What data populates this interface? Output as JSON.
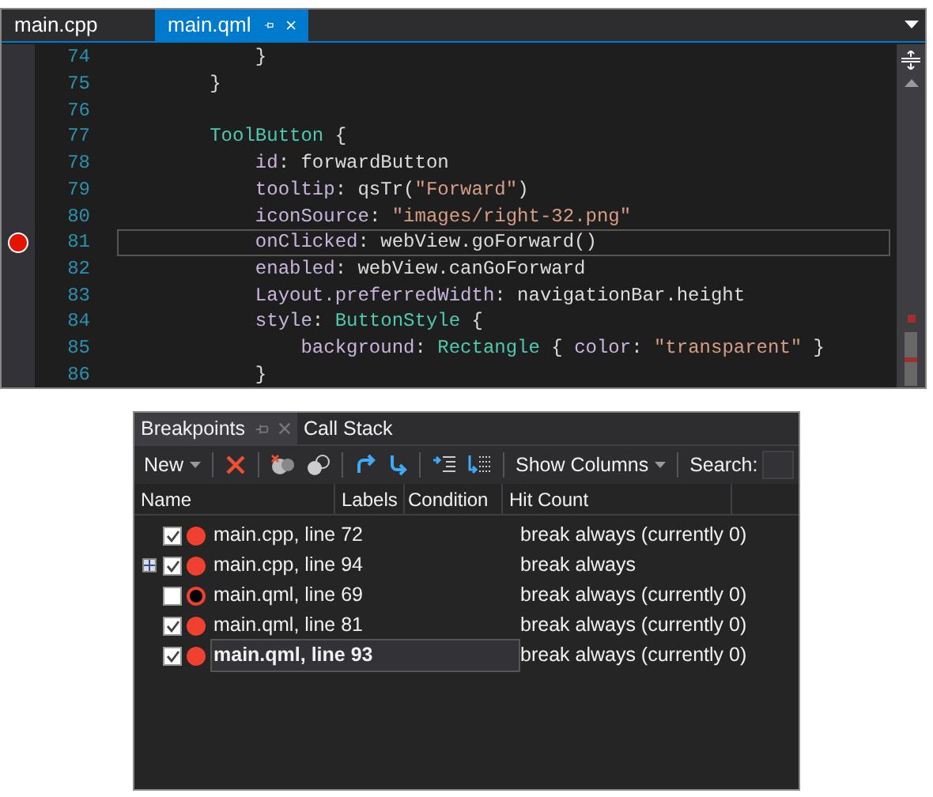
{
  "editor": {
    "tabs": [
      {
        "label": "main.cpp",
        "selected": false
      },
      {
        "label": "main.qml",
        "selected": true
      }
    ],
    "lines": [
      {
        "number": "74",
        "breakpoint": false,
        "current": false,
        "tokens": [
          {
            "kind": "punct",
            "text": "            }"
          }
        ]
      },
      {
        "number": "75",
        "breakpoint": false,
        "current": false,
        "tokens": [
          {
            "kind": "punct",
            "text": "        }"
          }
        ]
      },
      {
        "number": "76",
        "breakpoint": false,
        "current": false
      },
      {
        "number": "77",
        "breakpoint": false,
        "current": false,
        "tokens": [
          {
            "kind": "type",
            "text": "        ToolButton"
          },
          {
            "kind": "punct",
            "text": " {"
          }
        ]
      },
      {
        "number": "78",
        "breakpoint": false,
        "current": false,
        "tokens": [
          {
            "kind": "prop",
            "text": "            id"
          },
          {
            "kind": "punct",
            "text": ": forwardButton"
          }
        ]
      },
      {
        "number": "79",
        "breakpoint": false,
        "current": false,
        "tokens": [
          {
            "kind": "prop",
            "text": "            tooltip"
          },
          {
            "kind": "punct",
            "text": ": qsTr("
          },
          {
            "kind": "string",
            "text": "\"Forward\""
          },
          {
            "kind": "punct",
            "text": ")"
          }
        ]
      },
      {
        "number": "80",
        "breakpoint": false,
        "current": false,
        "tokens": [
          {
            "kind": "prop",
            "text": "            iconSource"
          },
          {
            "kind": "punct",
            "text": ": "
          },
          {
            "kind": "string",
            "text": "\"images/right-32.png\""
          }
        ]
      },
      {
        "number": "81",
        "breakpoint": true,
        "current": true,
        "tokens": [
          {
            "kind": "prop",
            "text": "            onClicked"
          },
          {
            "kind": "punct",
            "text": ": webView.goForward()"
          }
        ]
      },
      {
        "number": "82",
        "breakpoint": false,
        "current": false,
        "tokens": [
          {
            "kind": "prop",
            "text": "            enabled"
          },
          {
            "kind": "punct",
            "text": ": webView.canGoForward"
          }
        ]
      },
      {
        "number": "83",
        "breakpoint": false,
        "current": false,
        "tokens": [
          {
            "kind": "prop",
            "text": "            Layout.preferredWidth"
          },
          {
            "kind": "punct",
            "text": ": navigationBar.height"
          }
        ]
      },
      {
        "number": "84",
        "breakpoint": false,
        "current": false,
        "tokens": [
          {
            "kind": "prop",
            "text": "            style"
          },
          {
            "kind": "punct",
            "text": ": "
          },
          {
            "kind": "type",
            "text": "ButtonStyle"
          },
          {
            "kind": "punct",
            "text": " {"
          }
        ]
      },
      {
        "number": "85",
        "breakpoint": false,
        "current": false,
        "tokens": [
          {
            "kind": "prop",
            "text": "                background"
          },
          {
            "kind": "punct",
            "text": ": "
          },
          {
            "kind": "type",
            "text": "Rectangle"
          },
          {
            "kind": "punct",
            "text": " { "
          },
          {
            "kind": "prop",
            "text": "color"
          },
          {
            "kind": "punct",
            "text": ": "
          },
          {
            "kind": "string",
            "text": "\"transparent\""
          },
          {
            "kind": "punct",
            "text": " }"
          }
        ]
      },
      {
        "number": "86",
        "breakpoint": false,
        "current": false,
        "tokens": [
          {
            "kind": "punct",
            "text": "            }"
          }
        ]
      }
    ]
  },
  "panel": {
    "tabs": [
      {
        "label": "Breakpoints",
        "selected": true
      },
      {
        "label": "Call Stack",
        "selected": false
      }
    ],
    "toolbar": {
      "new_label": "New",
      "show_columns_label": "Show Columns",
      "search_label": "Search:"
    },
    "columns": [
      "Name",
      "Labels",
      "Condition",
      "Hit Count"
    ],
    "rows": [
      {
        "kind": "leaf",
        "name": "main.cpp, line 72",
        "hit_count": "break always (currently 0)",
        "checked": true,
        "enabled": true,
        "selected": false
      },
      {
        "kind": "group",
        "name": "main.cpp, line 94",
        "hit_count": "break always",
        "checked": true,
        "enabled": true,
        "selected": false
      },
      {
        "kind": "leaf",
        "name": "main.qml, line 69",
        "hit_count": "break always (currently 0)",
        "checked": false,
        "enabled": false,
        "selected": false
      },
      {
        "kind": "leaf",
        "name": "main.qml, line 81",
        "hit_count": "break always (currently 0)",
        "checked": true,
        "enabled": true,
        "selected": false
      },
      {
        "kind": "leaf",
        "name": "main.qml, line 93",
        "hit_count": "break always (currently 0)",
        "checked": true,
        "enabled": true,
        "selected": true
      }
    ]
  }
}
